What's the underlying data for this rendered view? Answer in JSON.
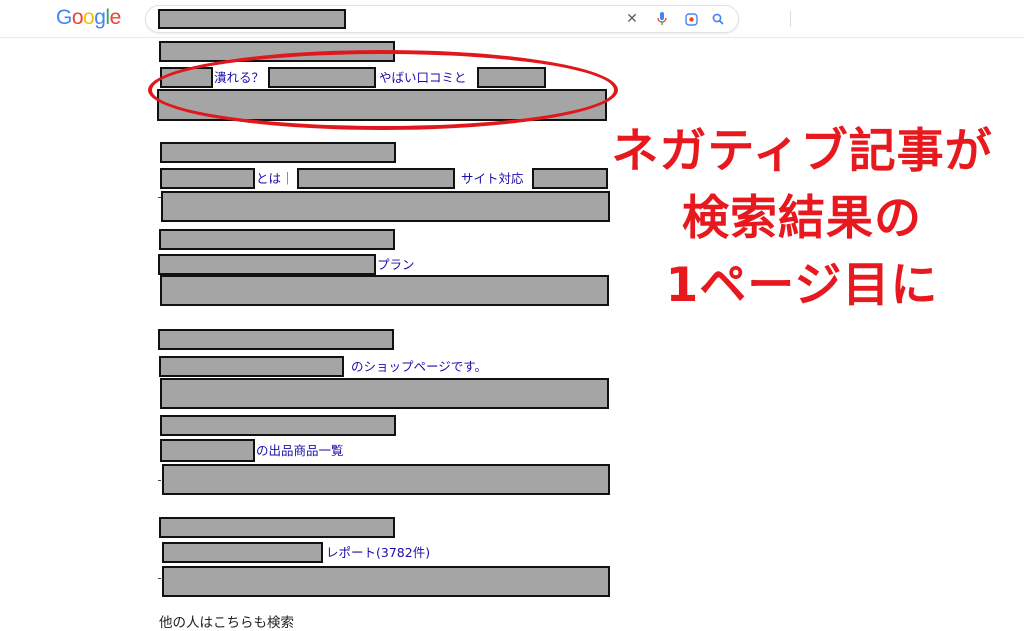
{
  "header": {
    "logo": {
      "g1": "G",
      "o1": "o",
      "o2": "o",
      "g2": "g",
      "l": "l",
      "e": "e"
    },
    "icons": [
      "close-icon",
      "microphone-icon",
      "lens-icon",
      "search-icon"
    ]
  },
  "results": [
    {
      "snippets": [
        "潰れる？",
        "やばい口コミと"
      ]
    },
    {
      "snippets": [
        "とは｜",
        "サイト対応"
      ]
    },
    {
      "snippets": [
        "プラン"
      ]
    },
    {
      "snippets": [
        "のショップページです。"
      ]
    },
    {
      "snippets": [
        "の出品商品一覧"
      ]
    },
    {
      "snippets": [
        "レポート(3782件)"
      ]
    }
  ],
  "related_heading": "他の人はこちらも検索",
  "annotation": {
    "lines": [
      "ネガティブ記事が",
      "検索結果の",
      "1ページ目に"
    ],
    "color": "#e8191e"
  }
}
